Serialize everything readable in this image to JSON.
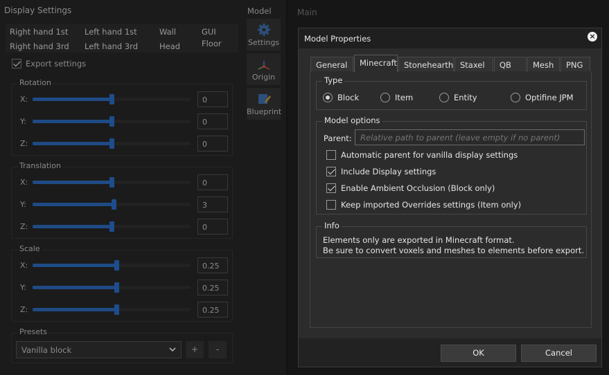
{
  "display_panel": {
    "title": "Display Settings",
    "hand_tabs": [
      "Right hand 1st",
      "Left hand 1st",
      "Wall",
      "GUI",
      "Right hand 3rd",
      "Left hand 3rd",
      "Head",
      "Floor"
    ],
    "export_label": "Export settings",
    "export_checked": true,
    "groups": {
      "rotation": {
        "label": "Rotation",
        "rows": [
          {
            "axis": "X:",
            "value": "0",
            "level": 0.5
          },
          {
            "axis": "Y:",
            "value": "0",
            "level": 0.5
          },
          {
            "axis": "Z:",
            "value": "0",
            "level": 0.5
          }
        ]
      },
      "translation": {
        "label": "Translation",
        "rows": [
          {
            "axis": "X:",
            "value": "0",
            "level": 0.5
          },
          {
            "axis": "Y:",
            "value": "3",
            "level": 0.515
          },
          {
            "axis": "Z:",
            "value": "0",
            "level": 0.5
          }
        ]
      },
      "scale": {
        "label": "Scale",
        "rows": [
          {
            "axis": "X:",
            "value": "0.25",
            "level": 0.53
          },
          {
            "axis": "Y:",
            "value": "0.25",
            "level": 0.53
          },
          {
            "axis": "Z:",
            "value": "0.25",
            "level": 0.53
          }
        ]
      }
    },
    "presets": {
      "label": "Presets",
      "selected": "Vanilla block",
      "add_label": "+",
      "remove_label": "-"
    }
  },
  "sidebar": {
    "title": "Model",
    "buttons": [
      "Settings",
      "Origin",
      "Blueprint"
    ]
  },
  "main": {
    "title": "Main"
  },
  "dialog": {
    "title": "Model Properties",
    "close_icon": "close-icon",
    "tabs": [
      "General",
      "Minecraft",
      "Stonehearth",
      "Staxel",
      "QB",
      "Mesh",
      "PNG"
    ],
    "active_tab": "Minecraft",
    "type": {
      "label": "Type",
      "options": [
        {
          "label": "Block",
          "selected": true
        },
        {
          "label": "Item",
          "selected": false
        },
        {
          "label": "Entity",
          "selected": false
        },
        {
          "label": "Optifine JPM",
          "selected": false
        }
      ]
    },
    "model_options": {
      "label": "Model options",
      "parent_label": "Parent:",
      "parent_placeholder": "Relative path to parent (leave empty if no parent)",
      "parent_value": "",
      "checkboxes": [
        {
          "label": "Automatic parent for vanilla display settings",
          "checked": false
        },
        {
          "label": "Include Display settings",
          "checked": true
        },
        {
          "label": "Enable Ambient Occlusion (Block only)",
          "checked": true
        },
        {
          "label": "Keep imported Overrides settings (Item only)",
          "checked": false
        }
      ]
    },
    "info": {
      "label": "Info",
      "lines": [
        "Elements only are exported in Minecraft format.",
        "Be sure to convert voxels and meshes to elements before export."
      ]
    },
    "ok_label": "OK",
    "cancel_label": "Cancel"
  },
  "colors": {
    "accent": "#1f4b85",
    "dialog_bg": "#2c2c2c",
    "panel_bg": "#1b1b1b"
  }
}
